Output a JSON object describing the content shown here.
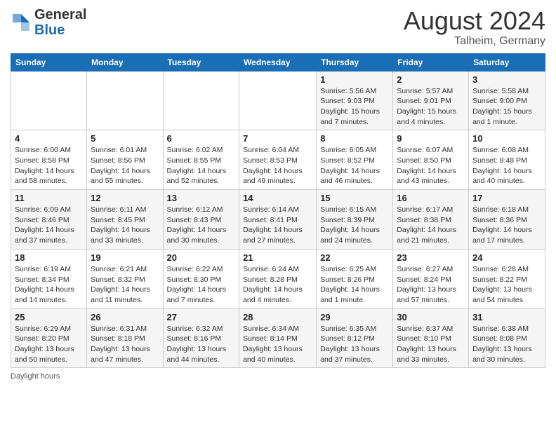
{
  "header": {
    "logo_general": "General",
    "logo_blue": "Blue",
    "month_year": "August 2024",
    "location": "Talheim, Germany"
  },
  "days_of_week": [
    "Sunday",
    "Monday",
    "Tuesday",
    "Wednesday",
    "Thursday",
    "Friday",
    "Saturday"
  ],
  "weeks": [
    [
      {
        "day": "",
        "info": ""
      },
      {
        "day": "",
        "info": ""
      },
      {
        "day": "",
        "info": ""
      },
      {
        "day": "",
        "info": ""
      },
      {
        "day": "1",
        "info": "Sunrise: 5:56 AM\nSunset: 9:03 PM\nDaylight: 15 hours and 7 minutes."
      },
      {
        "day": "2",
        "info": "Sunrise: 5:57 AM\nSunset: 9:01 PM\nDaylight: 15 hours and 4 minutes."
      },
      {
        "day": "3",
        "info": "Sunrise: 5:58 AM\nSunset: 9:00 PM\nDaylight: 15 hours and 1 minute."
      }
    ],
    [
      {
        "day": "4",
        "info": "Sunrise: 6:00 AM\nSunset: 8:58 PM\nDaylight: 14 hours and 58 minutes."
      },
      {
        "day": "5",
        "info": "Sunrise: 6:01 AM\nSunset: 8:56 PM\nDaylight: 14 hours and 55 minutes."
      },
      {
        "day": "6",
        "info": "Sunrise: 6:02 AM\nSunset: 8:55 PM\nDaylight: 14 hours and 52 minutes."
      },
      {
        "day": "7",
        "info": "Sunrise: 6:04 AM\nSunset: 8:53 PM\nDaylight: 14 hours and 49 minutes."
      },
      {
        "day": "8",
        "info": "Sunrise: 6:05 AM\nSunset: 8:52 PM\nDaylight: 14 hours and 46 minutes."
      },
      {
        "day": "9",
        "info": "Sunrise: 6:07 AM\nSunset: 8:50 PM\nDaylight: 14 hours and 43 minutes."
      },
      {
        "day": "10",
        "info": "Sunrise: 6:08 AM\nSunset: 8:48 PM\nDaylight: 14 hours and 40 minutes."
      }
    ],
    [
      {
        "day": "11",
        "info": "Sunrise: 6:09 AM\nSunset: 8:46 PM\nDaylight: 14 hours and 37 minutes."
      },
      {
        "day": "12",
        "info": "Sunrise: 6:11 AM\nSunset: 8:45 PM\nDaylight: 14 hours and 33 minutes."
      },
      {
        "day": "13",
        "info": "Sunrise: 6:12 AM\nSunset: 8:43 PM\nDaylight: 14 hours and 30 minutes."
      },
      {
        "day": "14",
        "info": "Sunrise: 6:14 AM\nSunset: 8:41 PM\nDaylight: 14 hours and 27 minutes."
      },
      {
        "day": "15",
        "info": "Sunrise: 6:15 AM\nSunset: 8:39 PM\nDaylight: 14 hours and 24 minutes."
      },
      {
        "day": "16",
        "info": "Sunrise: 6:17 AM\nSunset: 8:38 PM\nDaylight: 14 hours and 21 minutes."
      },
      {
        "day": "17",
        "info": "Sunrise: 6:18 AM\nSunset: 8:36 PM\nDaylight: 14 hours and 17 minutes."
      }
    ],
    [
      {
        "day": "18",
        "info": "Sunrise: 6:19 AM\nSunset: 8:34 PM\nDaylight: 14 hours and 14 minutes."
      },
      {
        "day": "19",
        "info": "Sunrise: 6:21 AM\nSunset: 8:32 PM\nDaylight: 14 hours and 11 minutes."
      },
      {
        "day": "20",
        "info": "Sunrise: 6:22 AM\nSunset: 8:30 PM\nDaylight: 14 hours and 7 minutes."
      },
      {
        "day": "21",
        "info": "Sunrise: 6:24 AM\nSunset: 8:28 PM\nDaylight: 14 hours and 4 minutes."
      },
      {
        "day": "22",
        "info": "Sunrise: 6:25 AM\nSunset: 8:26 PM\nDaylight: 14 hours and 1 minute."
      },
      {
        "day": "23",
        "info": "Sunrise: 6:27 AM\nSunset: 8:24 PM\nDaylight: 13 hours and 57 minutes."
      },
      {
        "day": "24",
        "info": "Sunrise: 6:28 AM\nSunset: 8:22 PM\nDaylight: 13 hours and 54 minutes."
      }
    ],
    [
      {
        "day": "25",
        "info": "Sunrise: 6:29 AM\nSunset: 8:20 PM\nDaylight: 13 hours and 50 minutes."
      },
      {
        "day": "26",
        "info": "Sunrise: 6:31 AM\nSunset: 8:18 PM\nDaylight: 13 hours and 47 minutes."
      },
      {
        "day": "27",
        "info": "Sunrise: 6:32 AM\nSunset: 8:16 PM\nDaylight: 13 hours and 44 minutes."
      },
      {
        "day": "28",
        "info": "Sunrise: 6:34 AM\nSunset: 8:14 PM\nDaylight: 13 hours and 40 minutes."
      },
      {
        "day": "29",
        "info": "Sunrise: 6:35 AM\nSunset: 8:12 PM\nDaylight: 13 hours and 37 minutes."
      },
      {
        "day": "30",
        "info": "Sunrise: 6:37 AM\nSunset: 8:10 PM\nDaylight: 13 hours and 33 minutes."
      },
      {
        "day": "31",
        "info": "Sunrise: 6:38 AM\nSunset: 8:08 PM\nDaylight: 13 hours and 30 minutes."
      }
    ]
  ],
  "footer": {
    "daylight_label": "Daylight hours"
  }
}
